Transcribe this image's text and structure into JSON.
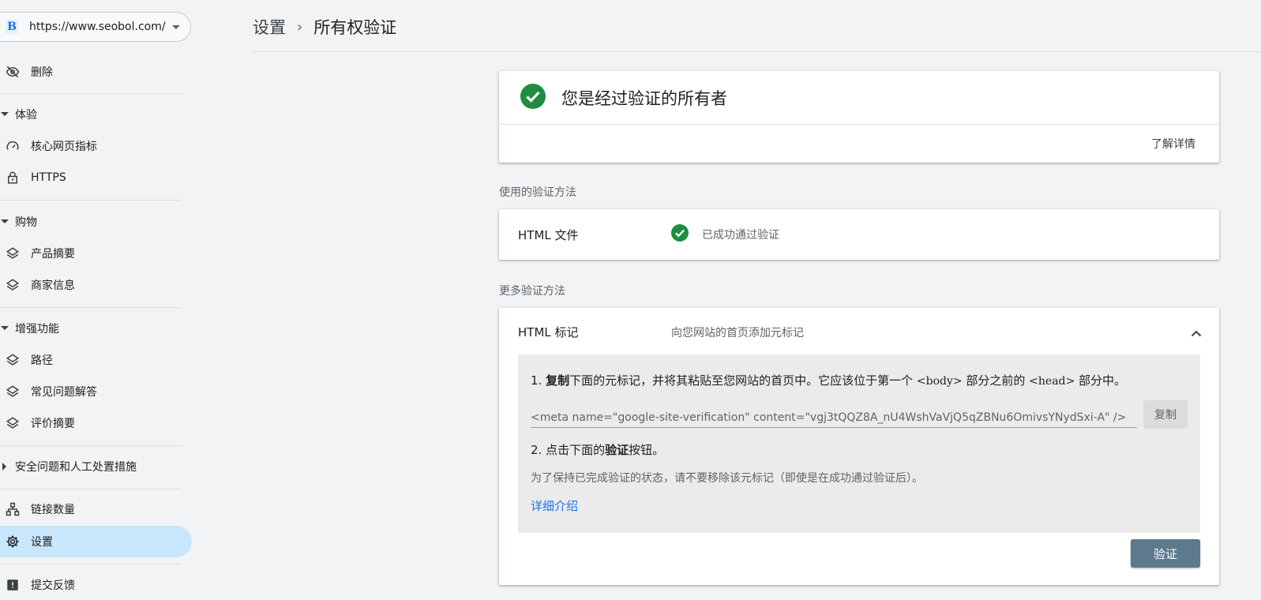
{
  "property": {
    "favicon_letter": "B",
    "url": "https://www.seobol.com/"
  },
  "breadcrumb": {
    "parent": "设置",
    "separator": "›",
    "current": "所有权验证"
  },
  "sidebar": {
    "remove": "删除",
    "experience": {
      "title": "体验",
      "items": [
        "核心网页指标",
        "HTTPS"
      ]
    },
    "shopping": {
      "title": "购物",
      "items": [
        "产品摘要",
        "商家信息"
      ]
    },
    "enhancements": {
      "title": "增强功能",
      "items": [
        "路径",
        "常见问题解答",
        "评价摘要"
      ]
    },
    "security": {
      "title": "安全问题和人工处置措施"
    },
    "links": "链接数量",
    "settings": "设置",
    "feedback": "提交反馈"
  },
  "owner_card": {
    "title": "您是经过验证的所有者",
    "learn_more": "了解详情"
  },
  "used_methods": {
    "label": "使用的验证方法",
    "method": "HTML 文件",
    "status": "已成功通过验证"
  },
  "more_methods": {
    "label": "更多验证方法",
    "method": "HTML 标记",
    "description": "向您网站的首页添加元标记",
    "step1_prefix": "1. ",
    "step1_bold": "复制",
    "step1_text_a": "下面的元标记，并将其粘贴至您网站的首页中。它应该位于第一个 ",
    "step1_code_body": "<body>",
    "step1_text_b": " 部分之前的 ",
    "step1_code_head": "<head>",
    "step1_text_c": " 部分中。",
    "meta_tag": "<meta name=\"google-site-verification\" content=\"vgj3tQQZ8A_nU4WshVaVjQ5qZBNu6OmivsYNydSxi-A\" />",
    "copy_label": "复制",
    "step2_prefix": "2. 点击下面的",
    "step2_bold": "验证",
    "step2_suffix": "按钮。",
    "keep_note": "为了保持已完成验证的状态，请不要移除该元标记（即使是在成功通过验证后）。",
    "detail_link": "详细介绍",
    "verify_label": "验证"
  },
  "colors": {
    "accent": "#1a73e8",
    "success": "#1e8e3e",
    "active_nav": "#c8e6fc",
    "verify_button": "#5c7a8c"
  }
}
